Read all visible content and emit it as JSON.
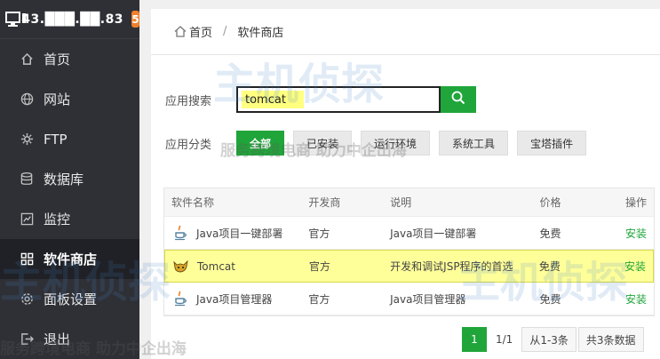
{
  "sidebar": {
    "server_ip": "43.███.██.83",
    "badge": "5",
    "items": [
      {
        "label": "首页",
        "icon": "home-icon",
        "active": false
      },
      {
        "label": "网站",
        "icon": "globe-icon",
        "active": false
      },
      {
        "label": "FTP",
        "icon": "ftp-icon",
        "active": false
      },
      {
        "label": "数据库",
        "icon": "database-icon",
        "active": false
      },
      {
        "label": "监控",
        "icon": "monitor-chart-icon",
        "active": false
      },
      {
        "label": "软件商店",
        "icon": "grid-icon",
        "active": true
      },
      {
        "label": "面板设置",
        "icon": "settings-icon",
        "active": false
      },
      {
        "label": "退出",
        "icon": "logout-icon",
        "active": false
      }
    ]
  },
  "breadcrumb": {
    "home": "首页",
    "current": "软件商店"
  },
  "search": {
    "label": "应用搜索",
    "value": "tomcat"
  },
  "category": {
    "label": "应用分类",
    "items": [
      "全部",
      "已安装",
      "运行环境",
      "系统工具",
      "宝塔插件"
    ],
    "active_index": 0
  },
  "table": {
    "headers": [
      "软件名称",
      "开发商",
      "说明",
      "价格",
      "操作"
    ],
    "rows": [
      {
        "name": "Java项目一键部署",
        "dev": "官方",
        "desc": "Java项目一键部署",
        "price": "免费",
        "op": "安装",
        "icon": "java-icon"
      },
      {
        "name": "Tomcat",
        "dev": "官方",
        "desc": "开发和调试JSP程序的首选",
        "price": "免费",
        "op": "安装",
        "icon": "tomcat-icon",
        "highlight": true
      },
      {
        "name": "Java项目管理器",
        "dev": "官方",
        "desc": "Java项目管理器",
        "price": "免费",
        "op": "安装",
        "icon": "java-icon"
      }
    ]
  },
  "pager": {
    "current": "1",
    "total_pages": "1/1",
    "range": "从1-3条",
    "total": "共3条数据"
  },
  "watermark": {
    "brand": "主机侦探",
    "slogan": "服务跨境电商 助力中企出海"
  },
  "colors": {
    "accent": "#20a53a",
    "sidebar": "#2f3036",
    "badge": "#f0802d",
    "highlight": "#ffff9a"
  }
}
